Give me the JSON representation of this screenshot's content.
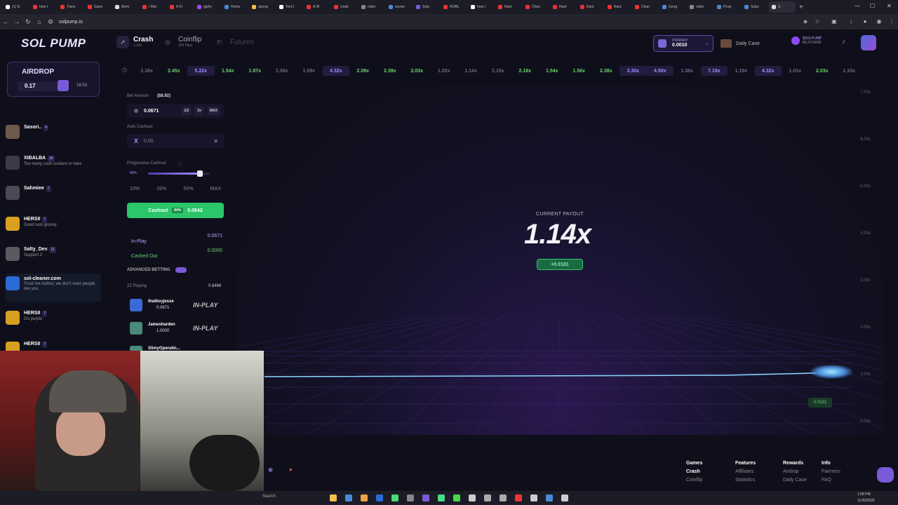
{
  "browser": {
    "tabs": [
      "(1) N",
      "how t",
      "Trans",
      "Gami",
      "Mem",
      "I Met",
      "A Fr",
      "giphy",
      "Home",
      "spong",
      "Text t",
      "A W",
      "Unde",
      "roblo",
      "mome",
      "Solp",
      "ROBL",
      "how t",
      "Rant",
      "Chan",
      "Rant",
      "Rant",
      "Rant",
      "Chan",
      "Goog",
      "roblo",
      "Proje",
      "Subs",
      "S"
    ],
    "url": "solpump.io",
    "new_tab": "+"
  },
  "header": {
    "logo": "SOL PUMP",
    "nav": [
      {
        "title": "Crash",
        "sub": "1.14x",
        "icon": "rocket-icon"
      },
      {
        "title": "Coinflip",
        "sub": "150 Flips",
        "icon": "coin-icon"
      },
      {
        "title": "Futures",
        "sub": "",
        "icon": "chart-icon"
      }
    ],
    "primary_label": "PRIMARY",
    "primary_value": "0.0010",
    "daily_case": "Daily Case",
    "solpump_label": "$SOLPUMP",
    "solpump_value": "80.3710000"
  },
  "multipliers": [
    "1.30x",
    "2.45x",
    "5.22x",
    "1.54x",
    "1.87x",
    "1.30x",
    "1.09x",
    "4.32x",
    "2.08x",
    "2.39x",
    "2.03x",
    "1.02x",
    "1.14x",
    "1.15x",
    "2.16x",
    "1.54x",
    "1.56x",
    "2.38x",
    "3.30x",
    "4.50x",
    "1.36x",
    "7.19x",
    "1.19x",
    "4.32x",
    "1.01x",
    "2.03x",
    "1.33x"
  ],
  "multiplier_kinds": [
    "lo",
    "mid",
    "hi",
    "mid",
    "mid",
    "lo",
    "lo",
    "hi",
    "mid",
    "mid",
    "mid",
    "lo",
    "lo",
    "lo",
    "mid",
    "mid",
    "mid",
    "mid",
    "hi",
    "hi",
    "lo",
    "hi",
    "lo",
    "hi",
    "lo",
    "mid",
    "lo"
  ],
  "airdrop": {
    "title": "AIRDROP",
    "amount": "0.17",
    "timer": "18:53"
  },
  "chat": [
    {
      "name": "Sasori..",
      "level": "4",
      "text": "",
      "color": "#6d5a4a"
    },
    {
      "name": "XIBALBA",
      "level": "25",
      "text": "Too many cock suckers in here",
      "color": "#3b3b48"
    },
    {
      "name": "Sahmiee",
      "level": "7",
      "text": "",
      "color": "#4a4a55"
    },
    {
      "name": "HERSII",
      "level": "7",
      "text": "Good luck groovy",
      "color": "#d8a020"
    },
    {
      "name": "Salty_Dev",
      "level": "11",
      "text": "Support 2",
      "color": "#5a5a60"
    },
    {
      "name": "sol-cleaner.com",
      "level": "",
      "text": "Trust me Author, we don't want people like you.",
      "color": "#2a6bd8"
    },
    {
      "name": "HERSII",
      "level": "7",
      "text": "Go purple",
      "color": "#d8a020"
    },
    {
      "name": "HERSII",
      "level": "7",
      "text": "",
      "color": "#d8a020"
    }
  ],
  "bet": {
    "amount_label": "Bet Amount",
    "amount_usd": "($8.92)",
    "amount_value": "0.0671",
    "half": "1/2",
    "double": "2x",
    "max": "MAX",
    "auto_label": "Auto Cashout",
    "auto_value": "0.00",
    "prog_label": "Progressive Cashout",
    "prog_pct": "84%",
    "prog_level": 0.84,
    "presets": [
      "10%",
      "25%",
      "50%",
      "MAX"
    ],
    "cashout_label": "Cashout",
    "cashout_badge": "84%",
    "cashout_value": "0.0642",
    "inplay_label": "In-Play",
    "inplay_value": "0.0671",
    "cashed_label": "Cashed Out",
    "cashed_value": "0.0000",
    "advanced_label": "ADVANCED BETTING",
    "playing_label": "22 Playing",
    "playing_total": "0.8466",
    "players": [
      {
        "name": "thatboyjesse",
        "amount": "0.0671",
        "status": "IN-PLAY"
      },
      {
        "name": "Jamesharden",
        "amount": "1.0000",
        "status": "IN-PLAY"
      },
      {
        "name": "SlimyOperatin...",
        "amount": "",
        "status": ""
      }
    ]
  },
  "graph": {
    "y_labels": [
      "7.00x",
      "6.00x",
      "5.00x",
      "4.00x",
      "3.00x",
      "2.00x",
      "1.00x",
      "0.00x"
    ],
    "current_label": "CURRENT PAYOUT",
    "current_value": "1.14x",
    "gain": "+0.0181",
    "rocket_tag": "0.0181"
  },
  "footer": {
    "cols": [
      {
        "head": "Games",
        "items": [
          "Crash",
          "Coinflip"
        ]
      },
      {
        "head": "Features",
        "items": [
          "Affiliates",
          "Statistics"
        ]
      },
      {
        "head": "Rewards",
        "items": [
          "Airdrop",
          "Daily Case"
        ]
      },
      {
        "head": "Info",
        "items": [
          "Fairness",
          "FAQ"
        ]
      }
    ]
  },
  "taskbar": {
    "search": "Search",
    "time": "1:08 PM",
    "date": "11/20/2025"
  }
}
